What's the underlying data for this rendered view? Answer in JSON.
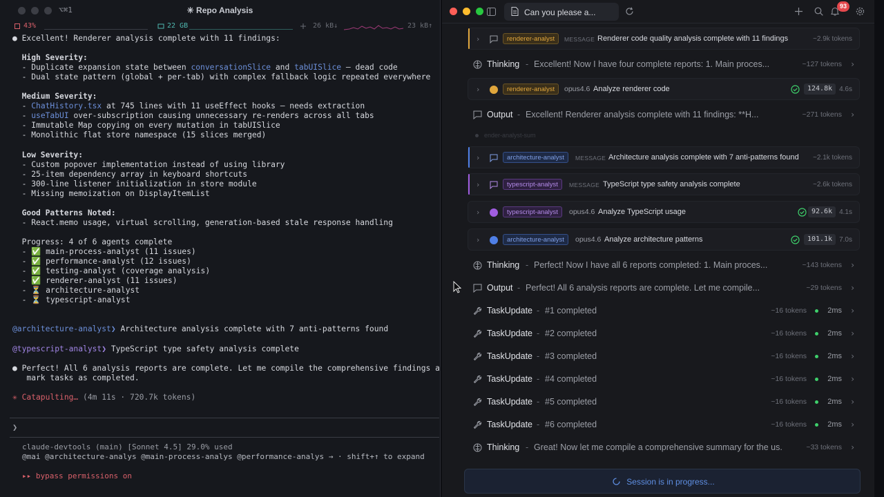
{
  "terminal": {
    "shortcut": "⌥⌘1",
    "title": "✳ Repo Analysis",
    "stats": {
      "cpu": "43%",
      "mem": "22 GB",
      "down": "26 kB↓",
      "up": "23 kB↑"
    },
    "lines": [
      [
        {
          "t": "● Excellent! Renderer analysis complete with 11 findings:"
        }
      ],
      [
        {
          "t": ""
        }
      ],
      [
        {
          "t": "  High Severity:",
          "c": "bold"
        }
      ],
      [
        {
          "t": "  - Duplicate expansion state between "
        },
        {
          "t": "conversationSlice",
          "c": "blue"
        },
        {
          "t": " and "
        },
        {
          "t": "tabUISlice",
          "c": "blue"
        },
        {
          "t": " — dead code"
        }
      ],
      [
        {
          "t": "  - Dual state pattern (global + per-tab) with complex fallback logic repeated everywhere"
        }
      ],
      [
        {
          "t": ""
        }
      ],
      [
        {
          "t": "  Medium Severity:",
          "c": "bold"
        }
      ],
      [
        {
          "t": "  - "
        },
        {
          "t": "ChatHistory.tsx",
          "c": "blue"
        },
        {
          "t": " at 745 lines with 11 useEffect hooks — needs extraction"
        }
      ],
      [
        {
          "t": "  - "
        },
        {
          "t": "useTabUI",
          "c": "blue"
        },
        {
          "t": " over-subscription causing unnecessary re-renders across all tabs"
        }
      ],
      [
        {
          "t": "  - Immutable Map copying on every mutation in tabUISlice"
        }
      ],
      [
        {
          "t": "  - Monolithic flat store namespace (15 slices merged)"
        }
      ],
      [
        {
          "t": ""
        }
      ],
      [
        {
          "t": "  Low Severity:",
          "c": "bold"
        }
      ],
      [
        {
          "t": "  - Custom popover implementation instead of using library"
        }
      ],
      [
        {
          "t": "  - 25-item dependency array in keyboard shortcuts"
        }
      ],
      [
        {
          "t": "  - 300-line listener initialization in store module"
        }
      ],
      [
        {
          "t": "  - Missing memoization on DisplayItemList"
        }
      ],
      [
        {
          "t": ""
        }
      ],
      [
        {
          "t": "  Good Patterns Noted:",
          "c": "bold"
        }
      ],
      [
        {
          "t": "  - React.memo usage, virtual scrolling, generation-based stale response handling"
        }
      ],
      [
        {
          "t": ""
        }
      ],
      [
        {
          "t": "  Progress: 4 of 6 agents complete"
        }
      ],
      [
        {
          "t": "  - ✅ main-process-analyst (11 issues)"
        }
      ],
      [
        {
          "t": "  - ✅ performance-analyst (12 issues)"
        }
      ],
      [
        {
          "t": "  - ✅ testing-analyst (coverage analysis)"
        }
      ],
      [
        {
          "t": "  - ✅ renderer-analyst (11 issues)"
        }
      ],
      [
        {
          "t": "  - ⏳ architecture-analyst"
        }
      ],
      [
        {
          "t": "  - ⏳ typescript-analyst"
        }
      ],
      [
        {
          "t": ""
        }
      ],
      [
        {
          "t": ""
        }
      ],
      [
        {
          "t": "@architecture-analyst❯",
          "c": "blue"
        },
        {
          "t": " Architecture analysis complete with 7 anti-patterns found"
        }
      ],
      [
        {
          "t": ""
        }
      ],
      [
        {
          "t": "@typescript-analyst❯",
          "c": "purple"
        },
        {
          "t": " TypeScript type safety analysis complete"
        }
      ],
      [
        {
          "t": ""
        }
      ],
      [
        {
          "t": "● Perfect! All 6 analysis reports are complete. Let me compile the comprehensive findings and"
        }
      ],
      [
        {
          "t": "   mark tasks as completed."
        }
      ],
      [
        {
          "t": ""
        }
      ],
      [
        {
          "t": "✳ Catapulting…",
          "c": "red"
        },
        {
          "t": " (4m 11s · 720.7k tokens)",
          "c": "dim"
        }
      ]
    ],
    "prompt": "❯",
    "status_line_1": "claude-devtools (main) [Sonnet 4.5] 29.0% used",
    "status_line_2": "@mai @architecture-analys @main-process-analys @performance-analys → · shift+↑ to expand",
    "bypass": "▸▸ bypass permissions on"
  },
  "app": {
    "tab_title": "Can you please a...",
    "notifications": "93",
    "colors": {
      "renderer": "#e0a63c",
      "architecture": "#4f7fe6",
      "typescript": "#a05de0",
      "success": "#3ecf6b",
      "accent": "#5f8fe3"
    },
    "cards": {
      "renderer_msg": {
        "agent": "renderer-analyst",
        "kind": "MESSAGE",
        "text": "Renderer code quality analysis complete with 11 findings",
        "tokens": "~2.9k tokens"
      },
      "renderer_task": {
        "agent": "renderer-analyst",
        "model": "opus4.6",
        "text": "Analyze renderer code",
        "metric": "124.8k",
        "duration": "4.6s"
      },
      "arch_msg": {
        "agent": "architecture-analyst",
        "kind": "MESSAGE",
        "text": "Architecture analysis complete with 7 anti-patterns found",
        "tokens": "~2.1k tokens"
      },
      "ts_msg": {
        "agent": "typescript-analyst",
        "kind": "MESSAGE",
        "text": "TypeScript type safety analysis complete",
        "tokens": "~2.6k tokens"
      },
      "ts_task": {
        "agent": "typescript-analyst",
        "model": "opus4.6",
        "text": "Analyze TypeScript usage",
        "metric": "92.6k",
        "duration": "4.1s"
      },
      "arch_task": {
        "agent": "architecture-analyst",
        "model": "opus4.6",
        "text": "Analyze architecture patterns",
        "metric": "101.1k",
        "duration": "7.0s"
      }
    },
    "rows": {
      "thinking1": {
        "label": "Thinking",
        "text": "Excellent! Now I have four complete reports: 1. Main proces...",
        "tokens": "~127 tokens"
      },
      "output1": {
        "label": "Output",
        "text": "Excellent! Renderer analysis complete with 11 findings: **H...",
        "tokens": "~271 tokens"
      },
      "ghost": "ender-analyst-sum",
      "thinking2": {
        "label": "Thinking",
        "text": "Perfect! Now I have all 6 reports completed: 1. Main proces...",
        "tokens": "~143 tokens"
      },
      "output2": {
        "label": "Output",
        "text": "Perfect! All 6 analysis reports are complete. Let me compile...",
        "tokens": "~29 tokens"
      },
      "task1": {
        "label": "TaskUpdate",
        "text": "#1 completed",
        "tokens": "~16 tokens",
        "ms": "2ms"
      },
      "task2": {
        "label": "TaskUpdate",
        "text": "#2 completed",
        "tokens": "~16 tokens",
        "ms": "2ms"
      },
      "task3": {
        "label": "TaskUpdate",
        "text": "#3 completed",
        "tokens": "~16 tokens",
        "ms": "2ms"
      },
      "task4": {
        "label": "TaskUpdate",
        "text": "#4 completed",
        "tokens": "~16 tokens",
        "ms": "2ms"
      },
      "task5": {
        "label": "TaskUpdate",
        "text": "#5 completed",
        "tokens": "~16 tokens",
        "ms": "2ms"
      },
      "task6": {
        "label": "TaskUpdate",
        "text": "#6 completed",
        "tokens": "~16 tokens",
        "ms": "2ms"
      },
      "thinking3": {
        "label": "Thinking",
        "text": "Great! Now let me compile a comprehensive summary for the us...",
        "tokens": "~33 tokens"
      }
    },
    "session_status": "Session is in progress..."
  }
}
